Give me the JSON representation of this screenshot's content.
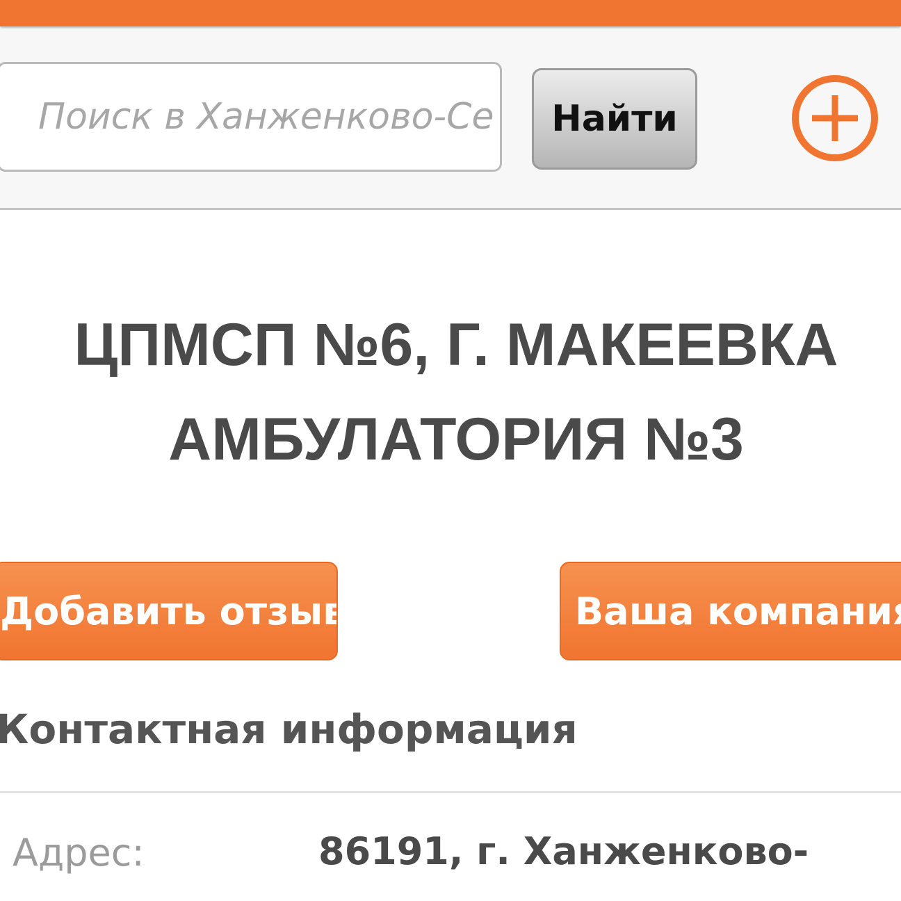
{
  "search": {
    "placeholder": "Поиск в Ханженково-Се",
    "button_label": "Найти"
  },
  "header": {
    "add_icon": "plus-circle-icon"
  },
  "company": {
    "title_line1": "ЦПМСП №6, Г. МАКЕЕВКА",
    "title_line2": "АМБУЛАТОРИЯ №3"
  },
  "actions": {
    "add_review": "Добавить отзыв",
    "your_company": "Ваша компания?"
  },
  "contacts": {
    "heading": "Контактная информация",
    "address_label": "Адрес:",
    "address_value": "86191, г. Ханженково-"
  },
  "colors": {
    "accent": "#f07530",
    "title_text": "#4a4a4a",
    "label_text": "#9b9b9b"
  }
}
